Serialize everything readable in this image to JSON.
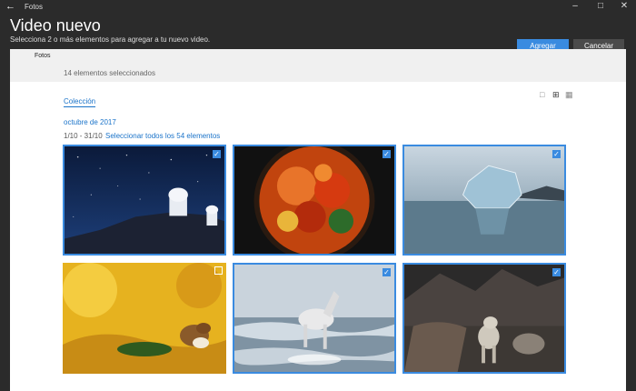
{
  "window": {
    "app_title": "Fotos"
  },
  "header": {
    "title": "Video nuevo",
    "subtitle": "Selecciona 2 o más elementos para agregar a tu nuevo video.",
    "add_label": "Agregar",
    "cancel_label": "Cancelar"
  },
  "panel": {
    "breadcrumb": "Fotos",
    "selected_count": "14 elementos seleccionados",
    "tab_label": "Colección"
  },
  "group": {
    "month": "octubre de 2017",
    "range": "1/10 - 31/10",
    "select_all": "Seleccionar todos los 54 elementos"
  },
  "photos": [
    {
      "name": "observatory-night",
      "selected": true
    },
    {
      "name": "autumn-tree-fisheye",
      "selected": true
    },
    {
      "name": "ice-block",
      "selected": true
    },
    {
      "name": "weasel-leaves",
      "selected": false
    },
    {
      "name": "white-horse-beach",
      "selected": true
    },
    {
      "name": "snow-leopard",
      "selected": true
    }
  ],
  "colors": {
    "accent": "#3a8be0",
    "background": "#2b2b2b"
  }
}
